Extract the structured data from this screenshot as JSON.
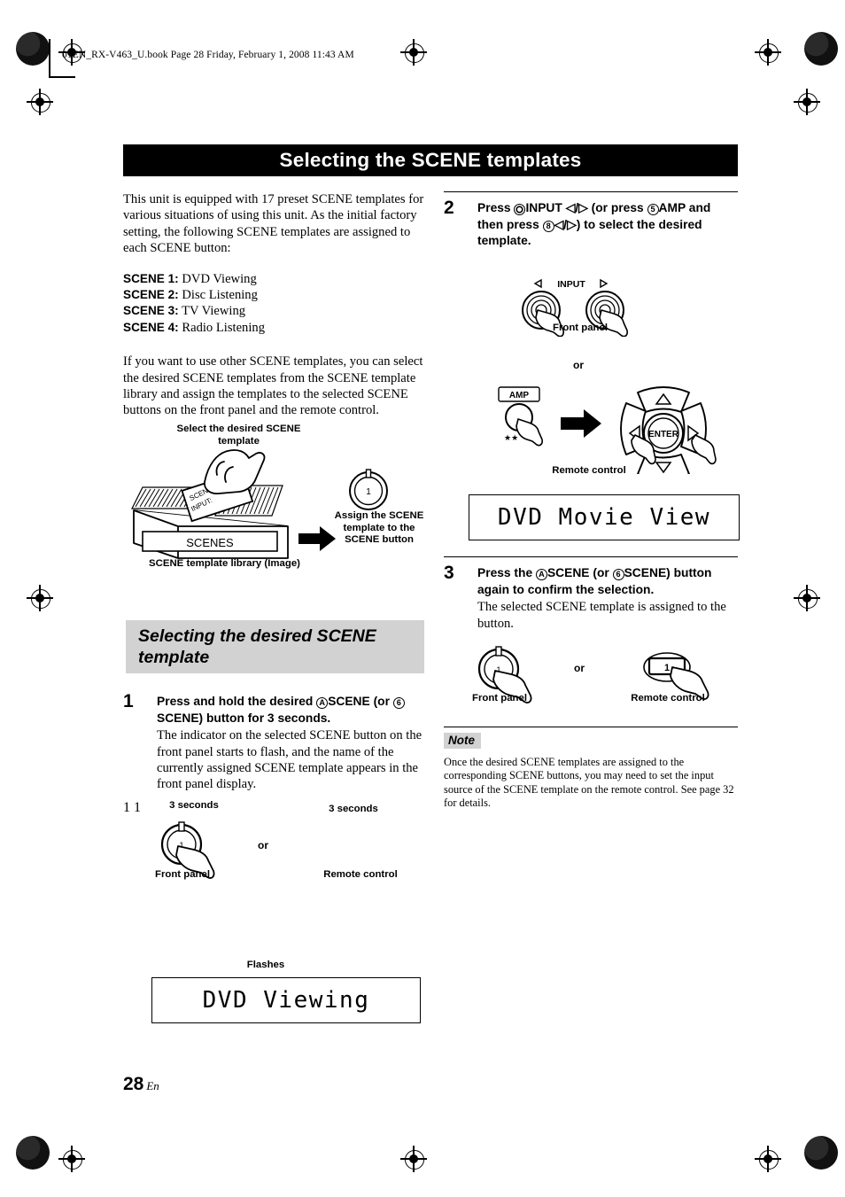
{
  "header": {
    "running_header": "01EN_RX-V463_U.book  Page 28  Friday, February 1, 2008  11:43 AM"
  },
  "title_bar": {
    "title": "Selecting the SCENE templates"
  },
  "left_column": {
    "intro_paragraph": "This unit is equipped with 17 preset SCENE templates for various situations of using this unit. As the initial factory setting, the following SCENE templates are assigned to each SCENE button:",
    "scene_list": [
      {
        "label": "SCENE 1:",
        "value": "DVD Viewing"
      },
      {
        "label": "SCENE 2:",
        "value": "Disc Listening"
      },
      {
        "label": "SCENE 3:",
        "value": "TV Viewing"
      },
      {
        "label": "SCENE 4:",
        "value": "Radio Listening"
      }
    ],
    "second_paragraph": "If you want to use other SCENE templates, you can select the desired SCENE templates from the SCENE template library and assign the templates to the selected SCENE buttons on the front panel and the remote control.",
    "figure_library": {
      "caption_select": "Select the desired SCENE template",
      "box_label": "SCENES",
      "card_label_line1": "SCENE",
      "card_label_line2": "INPUT:",
      "caption_library": "SCENE template library (Image)",
      "caption_assign": "Assign the SCENE template to the SCENE button",
      "button_number": "1"
    },
    "section_heading": "Selecting the desired SCENE template",
    "step1": {
      "number": "1",
      "lead_part1": "Press and hold the desired",
      "lead_circle_a": "A",
      "lead_part2": "SCENE",
      "lead_part3": "(or",
      "lead_circle_6": "6",
      "lead_part4": "SCENE",
      "lead_part5": ") button for 3 seconds.",
      "description": "The indicator on the selected SCENE button on the front panel starts to flash, and the name of the currently assigned SCENE template appears in the front panel display."
    },
    "figure_step1": {
      "label_3sec_left": "3 seconds",
      "label_3sec_right": "3 seconds",
      "label_front_panel": "Front panel",
      "label_remote": "Remote control",
      "label_or": "or",
      "label_flashes": "Flashes",
      "button_number": "1"
    },
    "lcd_display": {
      "text": "DVD Viewing"
    }
  },
  "right_column": {
    "step2": {
      "number": "2",
      "lead_part1": "Press",
      "lead_circle_o": "O",
      "lead_input": "INPUT",
      "lead_arrows1": "/",
      "lead_part2": "(or press",
      "lead_circle_5": "5",
      "lead_amp": "AMP",
      "lead_part3": "and then press",
      "lead_circle_8": "8",
      "lead_arrows2": "/",
      "lead_part4": ") to select the desired template."
    },
    "figure_step2": {
      "label_input": "INPUT",
      "label_front_panel": "Front panel",
      "label_or": "or",
      "label_amp": "AMP",
      "label_enter": "ENTER",
      "label_remote": "Remote control"
    },
    "lcd_display": {
      "text": "DVD Movie View"
    },
    "step3": {
      "number": "3",
      "lead_part1": "Press the",
      "lead_circle_a": "A",
      "lead_part2": "SCENE",
      "lead_part3": "(or",
      "lead_circle_6": "6",
      "lead_part4": "SCENE",
      "lead_part5": ") button again to confirm the selection.",
      "description": "The selected SCENE template is assigned to the button."
    },
    "figure_step3": {
      "label_front_panel": "Front panel",
      "label_or": "or",
      "label_remote": "Remote control",
      "button_number": "1"
    },
    "note": {
      "tag": "Note",
      "body": "Once the desired SCENE templates are assigned to the corresponding SCENE buttons, you may need to set the input source of the SCENE template on the remote control. See page 32 for details."
    }
  },
  "footer": {
    "page_number": "28",
    "language": "En"
  },
  "colors": {
    "title_bar_bg": "#000000",
    "heading_bg": "#d2d2d2",
    "note_tag_bg": "#d2d2d2"
  }
}
